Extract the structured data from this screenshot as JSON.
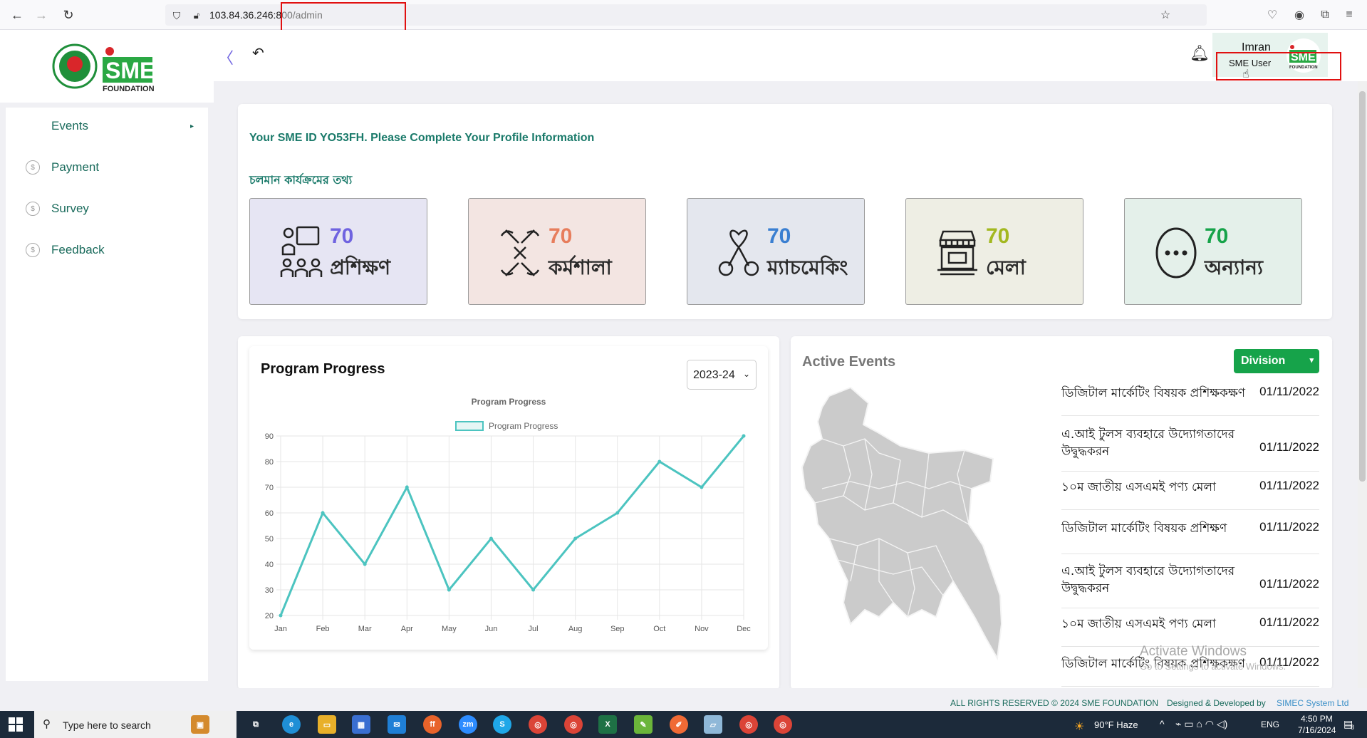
{
  "browser": {
    "url_host": "103.84.36.246:8",
    "url_path": "00/admin"
  },
  "header": {
    "user_name": "Imran",
    "user_role": "SME User",
    "logo_text": "SME",
    "logo_sub": "FOUNDATION"
  },
  "sidebar": {
    "items": [
      {
        "label": "Events",
        "has_arrow": true
      },
      {
        "label": "Payment"
      },
      {
        "label": "Survey"
      },
      {
        "label": "Feedback"
      }
    ]
  },
  "profile": {
    "notice": "Your SME ID YO53FH. Please Complete Your Profile Information",
    "section_title": "চলমান কার্যক্রমের তথ্য"
  },
  "stats": [
    {
      "value": "70",
      "label": "প্রশিক্ষণ",
      "color": "#6f63e0",
      "bg": "#e6e5f3",
      "icon": "training-icon"
    },
    {
      "value": "70",
      "label": "কর্মশালা",
      "color": "#e77d5c",
      "bg": "#f3e5e2",
      "icon": "workshop-icon"
    },
    {
      "value": "70",
      "label": "ম্যাচমেকিং",
      "color": "#3a7fd1",
      "bg": "#e4e7ee",
      "icon": "matchmaking-icon"
    },
    {
      "value": "70",
      "label": "মেলা",
      "color": "#a3b820",
      "bg": "#eeeee4",
      "icon": "fair-icon"
    },
    {
      "value": "70",
      "label": "অন্যান্য",
      "color": "#16a34a",
      "bg": "#e4f0ea",
      "icon": "more-icon"
    }
  ],
  "program": {
    "title": "Program Progress",
    "year": "2023-24"
  },
  "chart_data": {
    "type": "line",
    "title": "Program Progress",
    "categories": [
      "Jan",
      "Feb",
      "Mar",
      "Apr",
      "May",
      "Jun",
      "Jul",
      "Aug",
      "Sep",
      "Oct",
      "Nov",
      "Dec"
    ],
    "series": [
      {
        "name": "Program Progress",
        "values": [
          20,
          60,
          40,
          70,
          30,
          50,
          30,
          50,
          60,
          80,
          70,
          90
        ]
      }
    ],
    "ylim": [
      20,
      90
    ],
    "yticks": [
      20,
      30,
      40,
      50,
      60,
      70,
      80,
      90
    ],
    "color": "#4cc4c0",
    "grid": true,
    "legend": "top"
  },
  "active_events": {
    "title": "Active Events",
    "filter": "Division",
    "events": [
      {
        "name": "ডিজিটাল মার্কেটিং বিষয়ক প্রশিক্ষকক্ষণ",
        "date": "01/11/2022"
      },
      {
        "name": "এ.আই টুলস ব্যবহারে উদ্যোগতাদের উদ্বুদ্ধকরন",
        "date": "01/11/2022"
      },
      {
        "name": "১০ম জাতীয় এসএমই পণ্য মেলা",
        "date": "01/11/2022"
      },
      {
        "name": "ডিজিটাল মার্কেটিং বিষয়ক প্রশিক্ষণ",
        "date": "01/11/2022"
      },
      {
        "name": "এ.আই টুলস ব্যবহারে উদ্যোগতাদের উদ্বুদ্ধকরন",
        "date": "01/11/2022"
      },
      {
        "name": "১০ম জাতীয় এসএমই পণ্য মেলা",
        "date": "01/11/2022"
      },
      {
        "name": "ডিজিটাল মার্কেটিং বিষয়ক প্রশিক্ষকক্ষণ",
        "date": "01/11/2022"
      }
    ]
  },
  "watermark": {
    "line1": "Activate Windows",
    "line2": "Go to Settings to activate Windows."
  },
  "footer": {
    "rights": "ALL RIGHTS RESERVED © 2024 SME FOUNDATION",
    "designed": "Designed & Developed by",
    "company": "SIMEC System Ltd"
  },
  "taskbar": {
    "search_placeholder": "Type here to search",
    "weather": "90°F  Haze",
    "lang": "ENG",
    "time": "4:50 PM",
    "date": "7/16/2024",
    "notif_count": "8"
  }
}
